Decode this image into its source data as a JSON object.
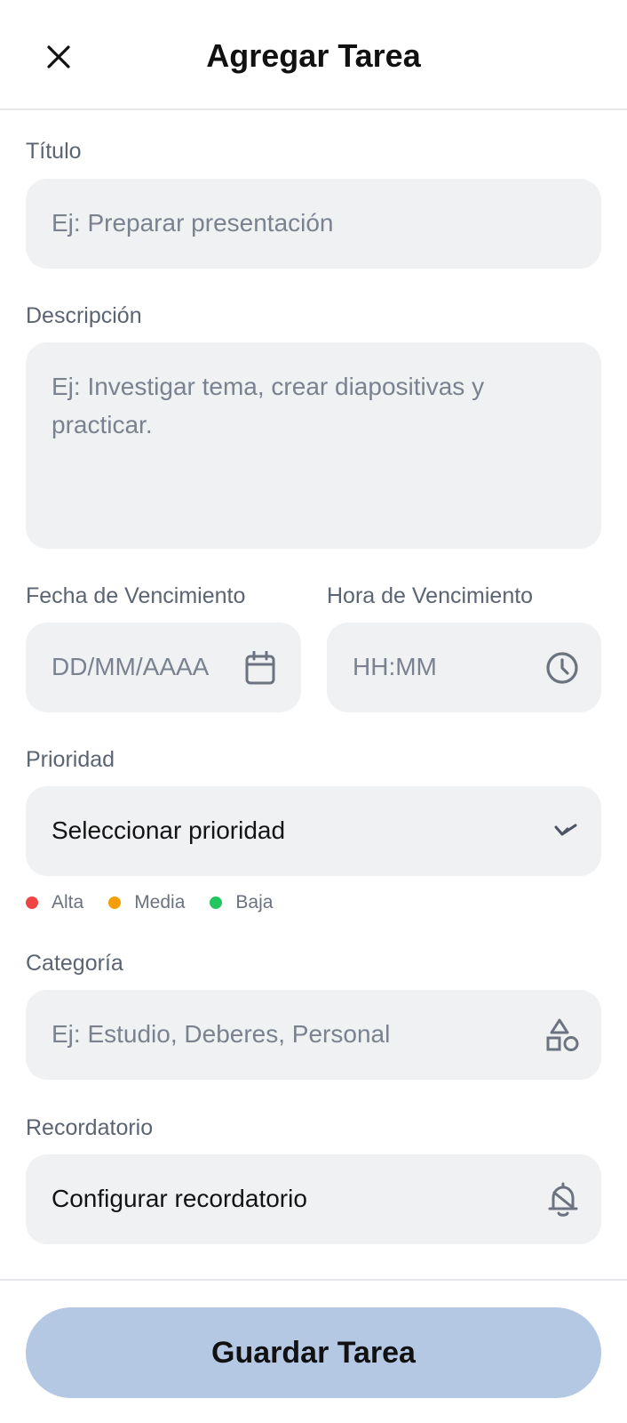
{
  "header": {
    "title": "Agregar Tarea",
    "close_icon": "close-icon"
  },
  "form": {
    "title_field": {
      "label": "Título",
      "placeholder": "Ej: Preparar presentación"
    },
    "description_field": {
      "label": "Descripción",
      "placeholder_line1": "Ej: Investigar tema, crear diapositivas y",
      "placeholder_line2": "practicar."
    },
    "due_date": {
      "label": "Fecha de Vencimiento",
      "placeholder": "DD/MM/AAAA",
      "icon": "calendar-icon"
    },
    "due_time": {
      "label": "Hora de Vencimiento",
      "placeholder": "HH:MM",
      "icon": "clock-icon"
    },
    "priority": {
      "label": "Prioridad",
      "value": "Seleccionar prioridad",
      "icon": "chevron-down-icon",
      "legend": [
        {
          "label": "Alta",
          "color": "#ef4444"
        },
        {
          "label": "Media",
          "color": "#f59e0b"
        },
        {
          "label": "Baja",
          "color": "#22c55e"
        }
      ]
    },
    "category": {
      "label": "Categoría",
      "placeholder": "Ej: Estudio, Deberes, Personal",
      "icon": "shapes-icon"
    },
    "reminder": {
      "label": "Recordatorio",
      "value": "Configurar recordatorio",
      "icon": "bell-icon"
    }
  },
  "footer": {
    "save_label": "Guardar Tarea",
    "save_color": "#b4c8e4"
  }
}
